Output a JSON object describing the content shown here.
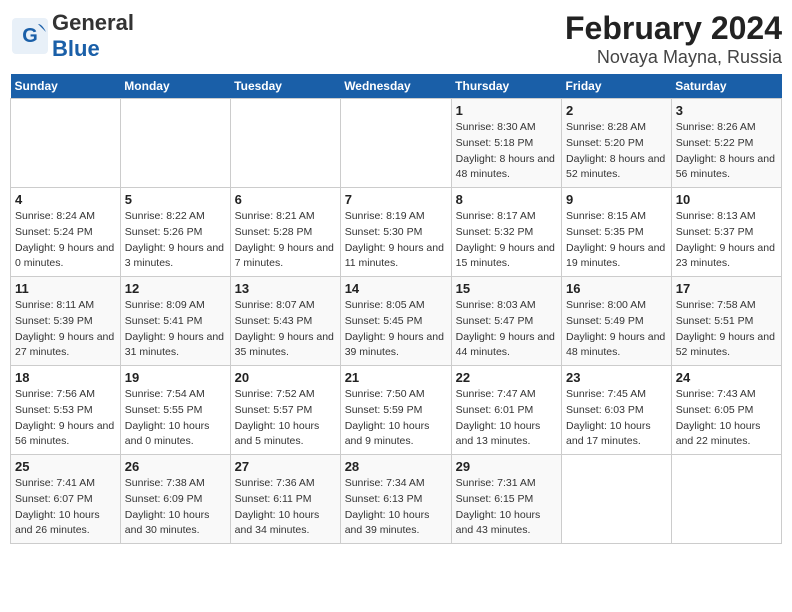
{
  "logo": {
    "general": "General",
    "blue": "Blue"
  },
  "title": "February 2024",
  "subtitle": "Novaya Mayna, Russia",
  "days_of_week": [
    "Sunday",
    "Monday",
    "Tuesday",
    "Wednesday",
    "Thursday",
    "Friday",
    "Saturday"
  ],
  "weeks": [
    {
      "cells": [
        {
          "empty": true
        },
        {
          "empty": true
        },
        {
          "empty": true
        },
        {
          "empty": true
        },
        {
          "day": 1,
          "sunrise": "8:30 AM",
          "sunset": "5:18 PM",
          "daylight": "8 hours and 48 minutes."
        },
        {
          "day": 2,
          "sunrise": "8:28 AM",
          "sunset": "5:20 PM",
          "daylight": "8 hours and 52 minutes."
        },
        {
          "day": 3,
          "sunrise": "8:26 AM",
          "sunset": "5:22 PM",
          "daylight": "8 hours and 56 minutes."
        }
      ]
    },
    {
      "cells": [
        {
          "day": 4,
          "sunrise": "8:24 AM",
          "sunset": "5:24 PM",
          "daylight": "9 hours and 0 minutes."
        },
        {
          "day": 5,
          "sunrise": "8:22 AM",
          "sunset": "5:26 PM",
          "daylight": "9 hours and 3 minutes."
        },
        {
          "day": 6,
          "sunrise": "8:21 AM",
          "sunset": "5:28 PM",
          "daylight": "9 hours and 7 minutes."
        },
        {
          "day": 7,
          "sunrise": "8:19 AM",
          "sunset": "5:30 PM",
          "daylight": "9 hours and 11 minutes."
        },
        {
          "day": 8,
          "sunrise": "8:17 AM",
          "sunset": "5:32 PM",
          "daylight": "9 hours and 15 minutes."
        },
        {
          "day": 9,
          "sunrise": "8:15 AM",
          "sunset": "5:35 PM",
          "daylight": "9 hours and 19 minutes."
        },
        {
          "day": 10,
          "sunrise": "8:13 AM",
          "sunset": "5:37 PM",
          "daylight": "9 hours and 23 minutes."
        }
      ]
    },
    {
      "cells": [
        {
          "day": 11,
          "sunrise": "8:11 AM",
          "sunset": "5:39 PM",
          "daylight": "9 hours and 27 minutes."
        },
        {
          "day": 12,
          "sunrise": "8:09 AM",
          "sunset": "5:41 PM",
          "daylight": "9 hours and 31 minutes."
        },
        {
          "day": 13,
          "sunrise": "8:07 AM",
          "sunset": "5:43 PM",
          "daylight": "9 hours and 35 minutes."
        },
        {
          "day": 14,
          "sunrise": "8:05 AM",
          "sunset": "5:45 PM",
          "daylight": "9 hours and 39 minutes."
        },
        {
          "day": 15,
          "sunrise": "8:03 AM",
          "sunset": "5:47 PM",
          "daylight": "9 hours and 44 minutes."
        },
        {
          "day": 16,
          "sunrise": "8:00 AM",
          "sunset": "5:49 PM",
          "daylight": "9 hours and 48 minutes."
        },
        {
          "day": 17,
          "sunrise": "7:58 AM",
          "sunset": "5:51 PM",
          "daylight": "9 hours and 52 minutes."
        }
      ]
    },
    {
      "cells": [
        {
          "day": 18,
          "sunrise": "7:56 AM",
          "sunset": "5:53 PM",
          "daylight": "9 hours and 56 minutes."
        },
        {
          "day": 19,
          "sunrise": "7:54 AM",
          "sunset": "5:55 PM",
          "daylight": "10 hours and 0 minutes."
        },
        {
          "day": 20,
          "sunrise": "7:52 AM",
          "sunset": "5:57 PM",
          "daylight": "10 hours and 5 minutes."
        },
        {
          "day": 21,
          "sunrise": "7:50 AM",
          "sunset": "5:59 PM",
          "daylight": "10 hours and 9 minutes."
        },
        {
          "day": 22,
          "sunrise": "7:47 AM",
          "sunset": "6:01 PM",
          "daylight": "10 hours and 13 minutes."
        },
        {
          "day": 23,
          "sunrise": "7:45 AM",
          "sunset": "6:03 PM",
          "daylight": "10 hours and 17 minutes."
        },
        {
          "day": 24,
          "sunrise": "7:43 AM",
          "sunset": "6:05 PM",
          "daylight": "10 hours and 22 minutes."
        }
      ]
    },
    {
      "cells": [
        {
          "day": 25,
          "sunrise": "7:41 AM",
          "sunset": "6:07 PM",
          "daylight": "10 hours and 26 minutes."
        },
        {
          "day": 26,
          "sunrise": "7:38 AM",
          "sunset": "6:09 PM",
          "daylight": "10 hours and 30 minutes."
        },
        {
          "day": 27,
          "sunrise": "7:36 AM",
          "sunset": "6:11 PM",
          "daylight": "10 hours and 34 minutes."
        },
        {
          "day": 28,
          "sunrise": "7:34 AM",
          "sunset": "6:13 PM",
          "daylight": "10 hours and 39 minutes."
        },
        {
          "day": 29,
          "sunrise": "7:31 AM",
          "sunset": "6:15 PM",
          "daylight": "10 hours and 43 minutes."
        },
        {
          "empty": true
        },
        {
          "empty": true
        }
      ]
    }
  ],
  "labels": {
    "sunrise": "Sunrise:",
    "sunset": "Sunset:",
    "daylight": "Daylight:"
  }
}
